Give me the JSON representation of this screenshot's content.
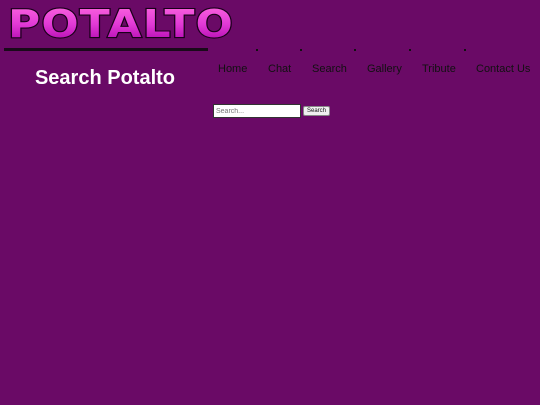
{
  "site": {
    "logo_text": "POTALTO"
  },
  "page": {
    "title": "Search Potalto"
  },
  "nav": {
    "items": [
      {
        "label": "Home"
      },
      {
        "label": "Chat"
      },
      {
        "label": "Search"
      },
      {
        "label": "Gallery"
      },
      {
        "label": "Tribute"
      },
      {
        "label": "Contact Us"
      }
    ]
  },
  "search": {
    "placeholder": "Search...",
    "value": "",
    "button_label": "Search"
  },
  "colors": {
    "background": "#6a0a66",
    "logo_gradient_top": "#ff4fd8",
    "logo_gradient_bottom": "#b000b0",
    "logo_outline": "#1a001a",
    "title_text": "#ffffff",
    "nav_text": "#111111"
  }
}
